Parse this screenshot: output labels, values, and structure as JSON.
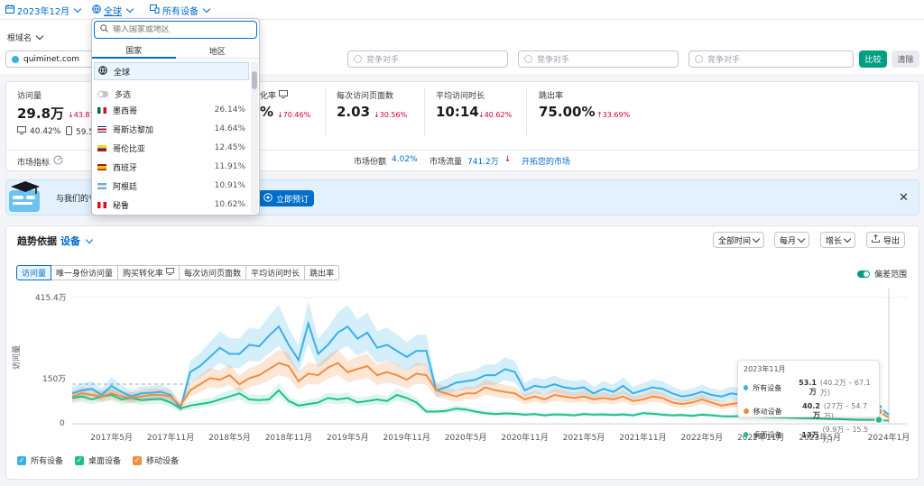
{
  "topbar": {
    "date_label": "2023年12月",
    "region_label": "全球",
    "device_label": "所有设备"
  },
  "filters": {
    "root_domain_label": "根域名",
    "domain_value": "quiminet.com",
    "competitor_placeholder": "竞争对手",
    "compare_label": "比较",
    "clear_label": "清除"
  },
  "metrics": {
    "visits": {
      "label": "访问量",
      "value": "29.8万",
      "delta": "↓43.87",
      "desktop": "40.42%",
      "mobile": "59.5"
    },
    "conversion": {
      "label_part": "化率",
      "value_part": "%",
      "delta": "↓70.46%"
    },
    "pages_per_visit": {
      "label": "每次访问页面数",
      "value": "2.03",
      "delta": "↓30.56%"
    },
    "avg_duration": {
      "label": "平均访问时长",
      "value": "10:14",
      "delta": "↓40.62%"
    },
    "bounce_rate": {
      "label": "跳出率",
      "value": "75.00%",
      "delta": "↑33.69%"
    }
  },
  "market": {
    "indicator_label": "市场指标",
    "share_label": "市场份额",
    "share_value": "4.02%",
    "traffic_label": "市场流量",
    "traffic_value": "741.2万",
    "explore_link": "开拓您的市场"
  },
  "banner": {
    "text": "与我们的专",
    "cta_label": "立即预订"
  },
  "trend": {
    "title": "趋势依据",
    "by_label": "设备",
    "tabs": [
      "访问量",
      "唯一身份访问量",
      "购买转化率",
      "每次访问页面数",
      "平均访问时长",
      "跳出率"
    ],
    "range_select": "全部时间",
    "interval_select": "每月",
    "metric_select": "增长",
    "export_label": "导出",
    "toggle_label": "偏差范围",
    "y_axis_label": "访问量",
    "legend": [
      "所有设备",
      "桌面设备",
      "移动设备"
    ]
  },
  "tooltip": {
    "title": "2023年11月",
    "rows": [
      {
        "name": "所有设备",
        "value": "53.1万",
        "range": "(40.2万 – 67.1万)"
      },
      {
        "name": "移动设备",
        "value": "40.2万",
        "range": "(27万 – 54.7万)"
      },
      {
        "name": "桌面设备",
        "value": "13万",
        "range": "(9.9万 – 15.5万)"
      }
    ]
  },
  "dropdown": {
    "search_placeholder": "输入国家或地区",
    "tab_country": "国家",
    "tab_region": "地区",
    "global_label": "全球",
    "multi_label": "多选",
    "countries": [
      {
        "name": "墨西哥",
        "share": "26.14%"
      },
      {
        "name": "哥斯达黎加",
        "share": "14.64%"
      },
      {
        "name": "哥伦比亚",
        "share": "12.45%"
      },
      {
        "name": "西班牙",
        "share": "11.91%"
      },
      {
        "name": "阿根廷",
        "share": "10.91%"
      },
      {
        "name": "秘鲁",
        "share": "10.62%"
      }
    ]
  },
  "colors": {
    "all_devices": "#3ab0e8",
    "desktop": "#1fbf8f",
    "mobile": "#f28d3f",
    "accent": "#006dca"
  },
  "chart_data": {
    "type": "line",
    "y_ticks": [
      "415.4万",
      "150万",
      "0"
    ],
    "ylim": [
      0,
      4154000
    ],
    "x_ticks": [
      "2017年5月",
      "2017年11月",
      "2018年5月",
      "2018年11月",
      "2019年5月",
      "2019年11月",
      "2020年5月",
      "2020年11月",
      "2021年5月",
      "2021年11月",
      "2022年5月",
      "2022年11月",
      "2023年5月",
      "2024年1月"
    ],
    "x": [
      "2017-01",
      "2017-02",
      "2017-03",
      "2017-04",
      "2017-05",
      "2017-06",
      "2017-07",
      "2017-08",
      "2017-09",
      "2017-10",
      "2017-11",
      "2017-12",
      "2018-01",
      "2018-02",
      "2018-03",
      "2018-04",
      "2018-05",
      "2018-06",
      "2018-07",
      "2018-08",
      "2018-09",
      "2018-10",
      "2018-11",
      "2018-12",
      "2019-01",
      "2019-02",
      "2019-03",
      "2019-04",
      "2019-05",
      "2019-06",
      "2019-07",
      "2019-08",
      "2019-09",
      "2019-10",
      "2019-11",
      "2019-12",
      "2020-01",
      "2020-02",
      "2020-03",
      "2020-04",
      "2020-05",
      "2020-06",
      "2020-07",
      "2020-08",
      "2020-09",
      "2020-10",
      "2020-11",
      "2020-12",
      "2021-01",
      "2021-02",
      "2021-03",
      "2021-04",
      "2021-05",
      "2021-06",
      "2021-07",
      "2021-08",
      "2021-09",
      "2021-10",
      "2021-11",
      "2021-12",
      "2022-01",
      "2022-02",
      "2022-03",
      "2022-04",
      "2022-05",
      "2022-06",
      "2022-07",
      "2022-08",
      "2022-09",
      "2022-10",
      "2022-11",
      "2022-12",
      "2023-01",
      "2023-02",
      "2023-03",
      "2023-04",
      "2023-05",
      "2023-06",
      "2023-07",
      "2023-08",
      "2023-09",
      "2023-10",
      "2023-11",
      "2023-12"
    ],
    "series": [
      {
        "name": "所有设备",
        "values": [
          1000000,
          1100000,
          1150000,
          950000,
          1250000,
          1050000,
          900000,
          1000000,
          1020000,
          1050000,
          950000,
          500000,
          1700000,
          1900000,
          2200000,
          2500000,
          2300000,
          2300000,
          2600000,
          2550000,
          2900000,
          3200000,
          2600000,
          2100000,
          3300000,
          2300000,
          2600000,
          3000000,
          3200000,
          2800000,
          3000000,
          2500000,
          2600000,
          2400000,
          2200000,
          2400000,
          2400000,
          1100000,
          1200000,
          1350000,
          1400000,
          1450000,
          1600000,
          1600000,
          1800000,
          1700000,
          1100000,
          1250000,
          1200000,
          1300000,
          1200000,
          1150000,
          1200000,
          1000000,
          1150000,
          1050000,
          1250000,
          1000000,
          1100000,
          1200000,
          1150000,
          1000000,
          900000,
          950000,
          1050000,
          950000,
          900000,
          1000000,
          950000,
          1100000,
          900000,
          750000,
          800000,
          700000,
          650000,
          600000,
          550000,
          520000,
          500000,
          480000,
          470000,
          460000,
          531000,
          298000
        ]
      },
      {
        "name": "桌面设备",
        "values": [
          850000,
          900000,
          800000,
          900000,
          950000,
          800000,
          850000,
          780000,
          800000,
          820000,
          700000,
          500000,
          600000,
          650000,
          700000,
          800000,
          900000,
          1000000,
          800000,
          780000,
          800000,
          1100000,
          750000,
          600000,
          650000,
          700000,
          850000,
          800000,
          850000,
          700000,
          750000,
          800000,
          750000,
          950000,
          850000,
          700000,
          400000,
          400000,
          420000,
          500000,
          470000,
          400000,
          350000,
          320000,
          340000,
          330000,
          300000,
          320000,
          280000,
          310000,
          300000,
          280000,
          320000,
          300000,
          310000,
          290000,
          310000,
          280000,
          350000,
          330000,
          300000,
          280000,
          290000,
          260000,
          300000,
          280000,
          250000,
          240000,
          260000,
          250000,
          230000,
          220000,
          210000,
          200000,
          190000,
          180000,
          170000,
          160000,
          150000,
          140000,
          130000,
          130000,
          130000,
          100000
        ]
      },
      {
        "name": "移动设备",
        "values": [
          900000,
          1000000,
          950000,
          900000,
          1000000,
          900000,
          850000,
          900000,
          950000,
          950000,
          900000,
          600000,
          1100000,
          1300000,
          1500000,
          1450000,
          1600000,
          1300000,
          1500000,
          1600000,
          1800000,
          2000000,
          1900000,
          1400000,
          1650000,
          1600000,
          1850000,
          2000000,
          1700000,
          1800000,
          1900000,
          1600000,
          1700000,
          1600000,
          1450000,
          1650000,
          1600000,
          1100000,
          1000000,
          900000,
          1000000,
          1000000,
          1200000,
          1100000,
          1050000,
          1000000,
          800000,
          900000,
          800000,
          950000,
          900000,
          850000,
          900000,
          800000,
          850000,
          800000,
          900000,
          750000,
          800000,
          900000,
          850000,
          700000,
          650000,
          700000,
          800000,
          700000,
          600000,
          650000,
          700000,
          800000,
          600000,
          500000,
          550000,
          450000,
          420000,
          400000,
          380000,
          360000,
          350000,
          340000,
          330000,
          320000,
          402000,
          198000
        ]
      }
    ]
  }
}
